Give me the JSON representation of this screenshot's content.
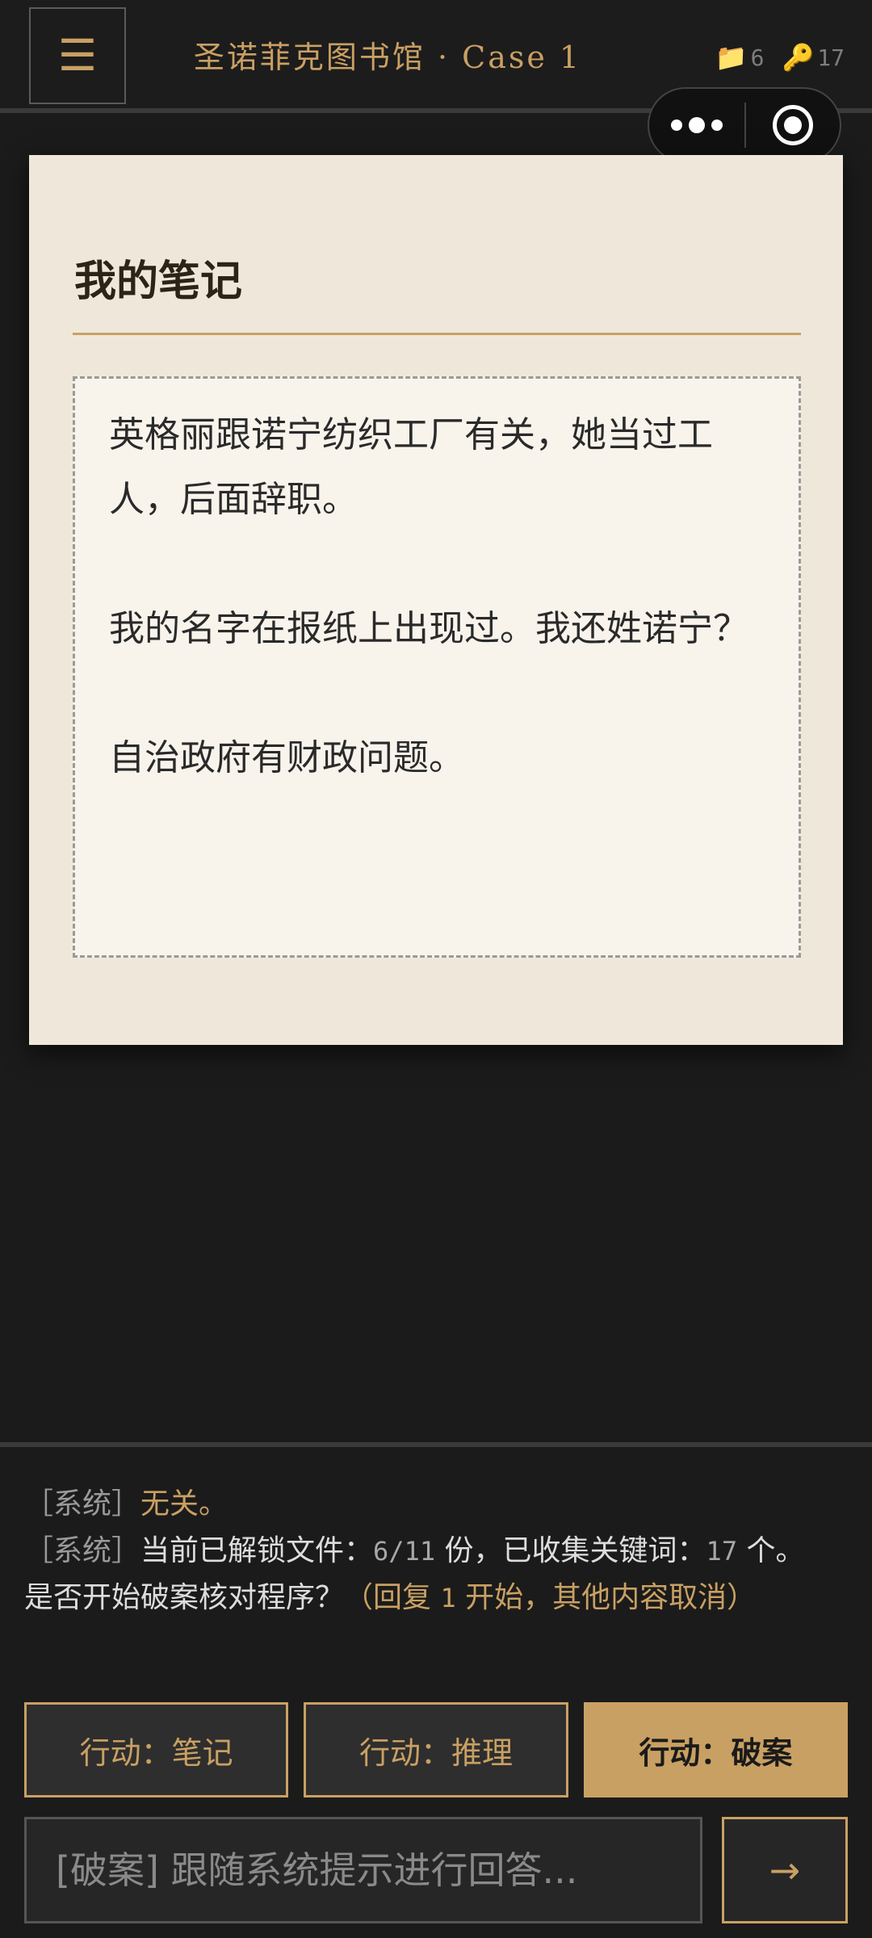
{
  "header": {
    "menu_icon": "☰",
    "title": "圣诺菲克图书馆 · Case 1",
    "files_icon": "📁",
    "files_count": "6",
    "keys_icon": "🔑",
    "keys_count": "17"
  },
  "note": {
    "title": "我的笔记",
    "content": "英格丽跟诺宁纺织工厂有关，她当过工人，后面辞职。\n\n我的名字在报纸上出现过。我还姓诺宁？\n\n自治政府有财政问题。"
  },
  "log": {
    "line1": {
      "tag": "［系统］",
      "text": "无关。"
    },
    "line2": {
      "tag": "［系统］",
      "text_a": "当前已解锁文件：",
      "files": "6/11",
      "text_b": " 份，已收集关键词：",
      "keywords": "17",
      "text_c": " 个。"
    },
    "line3": {
      "question": "是否开始破案核对程序？",
      "hint_a": "（回复 ",
      "hint_num": "1",
      "hint_b": " 开始，其他内容取消）"
    }
  },
  "actions": {
    "notes": "行动：笔记",
    "reason": "行动：推理",
    "solve": "行动：破案"
  },
  "input": {
    "placeholder": "[破案] 跟随系统提示进行回答...",
    "send": "→"
  },
  "colors": {
    "accent": "#c9a063",
    "background": "#1b1b1b",
    "card": "#efe8da"
  }
}
